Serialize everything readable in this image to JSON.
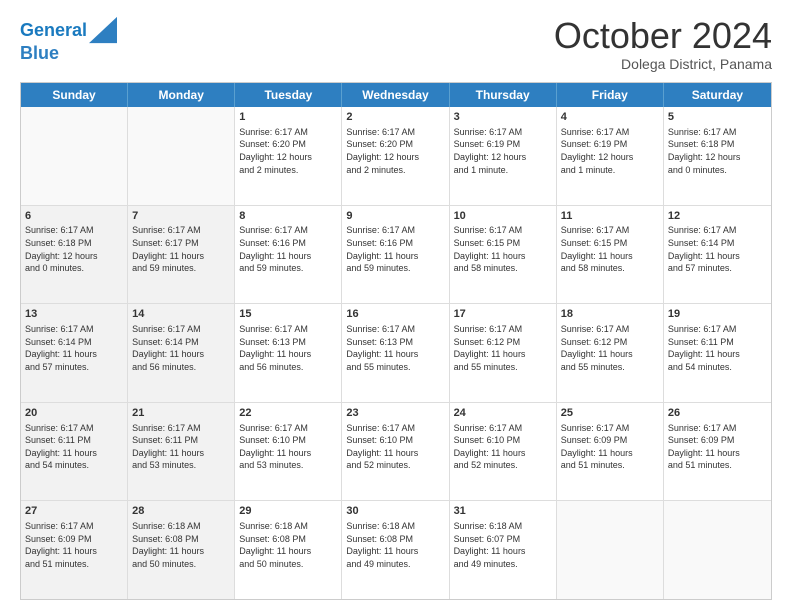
{
  "header": {
    "logo_line1": "General",
    "logo_line2": "Blue",
    "month": "October 2024",
    "location": "Dolega District, Panama"
  },
  "days": [
    "Sunday",
    "Monday",
    "Tuesday",
    "Wednesday",
    "Thursday",
    "Friday",
    "Saturday"
  ],
  "rows": [
    [
      {
        "num": "",
        "info": "",
        "empty": true
      },
      {
        "num": "",
        "info": "",
        "empty": true
      },
      {
        "num": "1",
        "info": "Sunrise: 6:17 AM\nSunset: 6:20 PM\nDaylight: 12 hours\nand 2 minutes."
      },
      {
        "num": "2",
        "info": "Sunrise: 6:17 AM\nSunset: 6:20 PM\nDaylight: 12 hours\nand 2 minutes."
      },
      {
        "num": "3",
        "info": "Sunrise: 6:17 AM\nSunset: 6:19 PM\nDaylight: 12 hours\nand 1 minute."
      },
      {
        "num": "4",
        "info": "Sunrise: 6:17 AM\nSunset: 6:19 PM\nDaylight: 12 hours\nand 1 minute."
      },
      {
        "num": "5",
        "info": "Sunrise: 6:17 AM\nSunset: 6:18 PM\nDaylight: 12 hours\nand 0 minutes."
      }
    ],
    [
      {
        "num": "6",
        "info": "Sunrise: 6:17 AM\nSunset: 6:18 PM\nDaylight: 12 hours\nand 0 minutes.",
        "shaded": true
      },
      {
        "num": "7",
        "info": "Sunrise: 6:17 AM\nSunset: 6:17 PM\nDaylight: 11 hours\nand 59 minutes.",
        "shaded": true
      },
      {
        "num": "8",
        "info": "Sunrise: 6:17 AM\nSunset: 6:16 PM\nDaylight: 11 hours\nand 59 minutes."
      },
      {
        "num": "9",
        "info": "Sunrise: 6:17 AM\nSunset: 6:16 PM\nDaylight: 11 hours\nand 59 minutes."
      },
      {
        "num": "10",
        "info": "Sunrise: 6:17 AM\nSunset: 6:15 PM\nDaylight: 11 hours\nand 58 minutes."
      },
      {
        "num": "11",
        "info": "Sunrise: 6:17 AM\nSunset: 6:15 PM\nDaylight: 11 hours\nand 58 minutes."
      },
      {
        "num": "12",
        "info": "Sunrise: 6:17 AM\nSunset: 6:14 PM\nDaylight: 11 hours\nand 57 minutes."
      }
    ],
    [
      {
        "num": "13",
        "info": "Sunrise: 6:17 AM\nSunset: 6:14 PM\nDaylight: 11 hours\nand 57 minutes.",
        "shaded": true
      },
      {
        "num": "14",
        "info": "Sunrise: 6:17 AM\nSunset: 6:14 PM\nDaylight: 11 hours\nand 56 minutes.",
        "shaded": true
      },
      {
        "num": "15",
        "info": "Sunrise: 6:17 AM\nSunset: 6:13 PM\nDaylight: 11 hours\nand 56 minutes."
      },
      {
        "num": "16",
        "info": "Sunrise: 6:17 AM\nSunset: 6:13 PM\nDaylight: 11 hours\nand 55 minutes."
      },
      {
        "num": "17",
        "info": "Sunrise: 6:17 AM\nSunset: 6:12 PM\nDaylight: 11 hours\nand 55 minutes."
      },
      {
        "num": "18",
        "info": "Sunrise: 6:17 AM\nSunset: 6:12 PM\nDaylight: 11 hours\nand 55 minutes."
      },
      {
        "num": "19",
        "info": "Sunrise: 6:17 AM\nSunset: 6:11 PM\nDaylight: 11 hours\nand 54 minutes."
      }
    ],
    [
      {
        "num": "20",
        "info": "Sunrise: 6:17 AM\nSunset: 6:11 PM\nDaylight: 11 hours\nand 54 minutes.",
        "shaded": true
      },
      {
        "num": "21",
        "info": "Sunrise: 6:17 AM\nSunset: 6:11 PM\nDaylight: 11 hours\nand 53 minutes.",
        "shaded": true
      },
      {
        "num": "22",
        "info": "Sunrise: 6:17 AM\nSunset: 6:10 PM\nDaylight: 11 hours\nand 53 minutes."
      },
      {
        "num": "23",
        "info": "Sunrise: 6:17 AM\nSunset: 6:10 PM\nDaylight: 11 hours\nand 52 minutes."
      },
      {
        "num": "24",
        "info": "Sunrise: 6:17 AM\nSunset: 6:10 PM\nDaylight: 11 hours\nand 52 minutes."
      },
      {
        "num": "25",
        "info": "Sunrise: 6:17 AM\nSunset: 6:09 PM\nDaylight: 11 hours\nand 51 minutes."
      },
      {
        "num": "26",
        "info": "Sunrise: 6:17 AM\nSunset: 6:09 PM\nDaylight: 11 hours\nand 51 minutes."
      }
    ],
    [
      {
        "num": "27",
        "info": "Sunrise: 6:17 AM\nSunset: 6:09 PM\nDaylight: 11 hours\nand 51 minutes.",
        "shaded": true
      },
      {
        "num": "28",
        "info": "Sunrise: 6:18 AM\nSunset: 6:08 PM\nDaylight: 11 hours\nand 50 minutes.",
        "shaded": true
      },
      {
        "num": "29",
        "info": "Sunrise: 6:18 AM\nSunset: 6:08 PM\nDaylight: 11 hours\nand 50 minutes."
      },
      {
        "num": "30",
        "info": "Sunrise: 6:18 AM\nSunset: 6:08 PM\nDaylight: 11 hours\nand 49 minutes."
      },
      {
        "num": "31",
        "info": "Sunrise: 6:18 AM\nSunset: 6:07 PM\nDaylight: 11 hours\nand 49 minutes."
      },
      {
        "num": "",
        "info": "",
        "empty": true
      },
      {
        "num": "",
        "info": "",
        "empty": true
      }
    ]
  ]
}
